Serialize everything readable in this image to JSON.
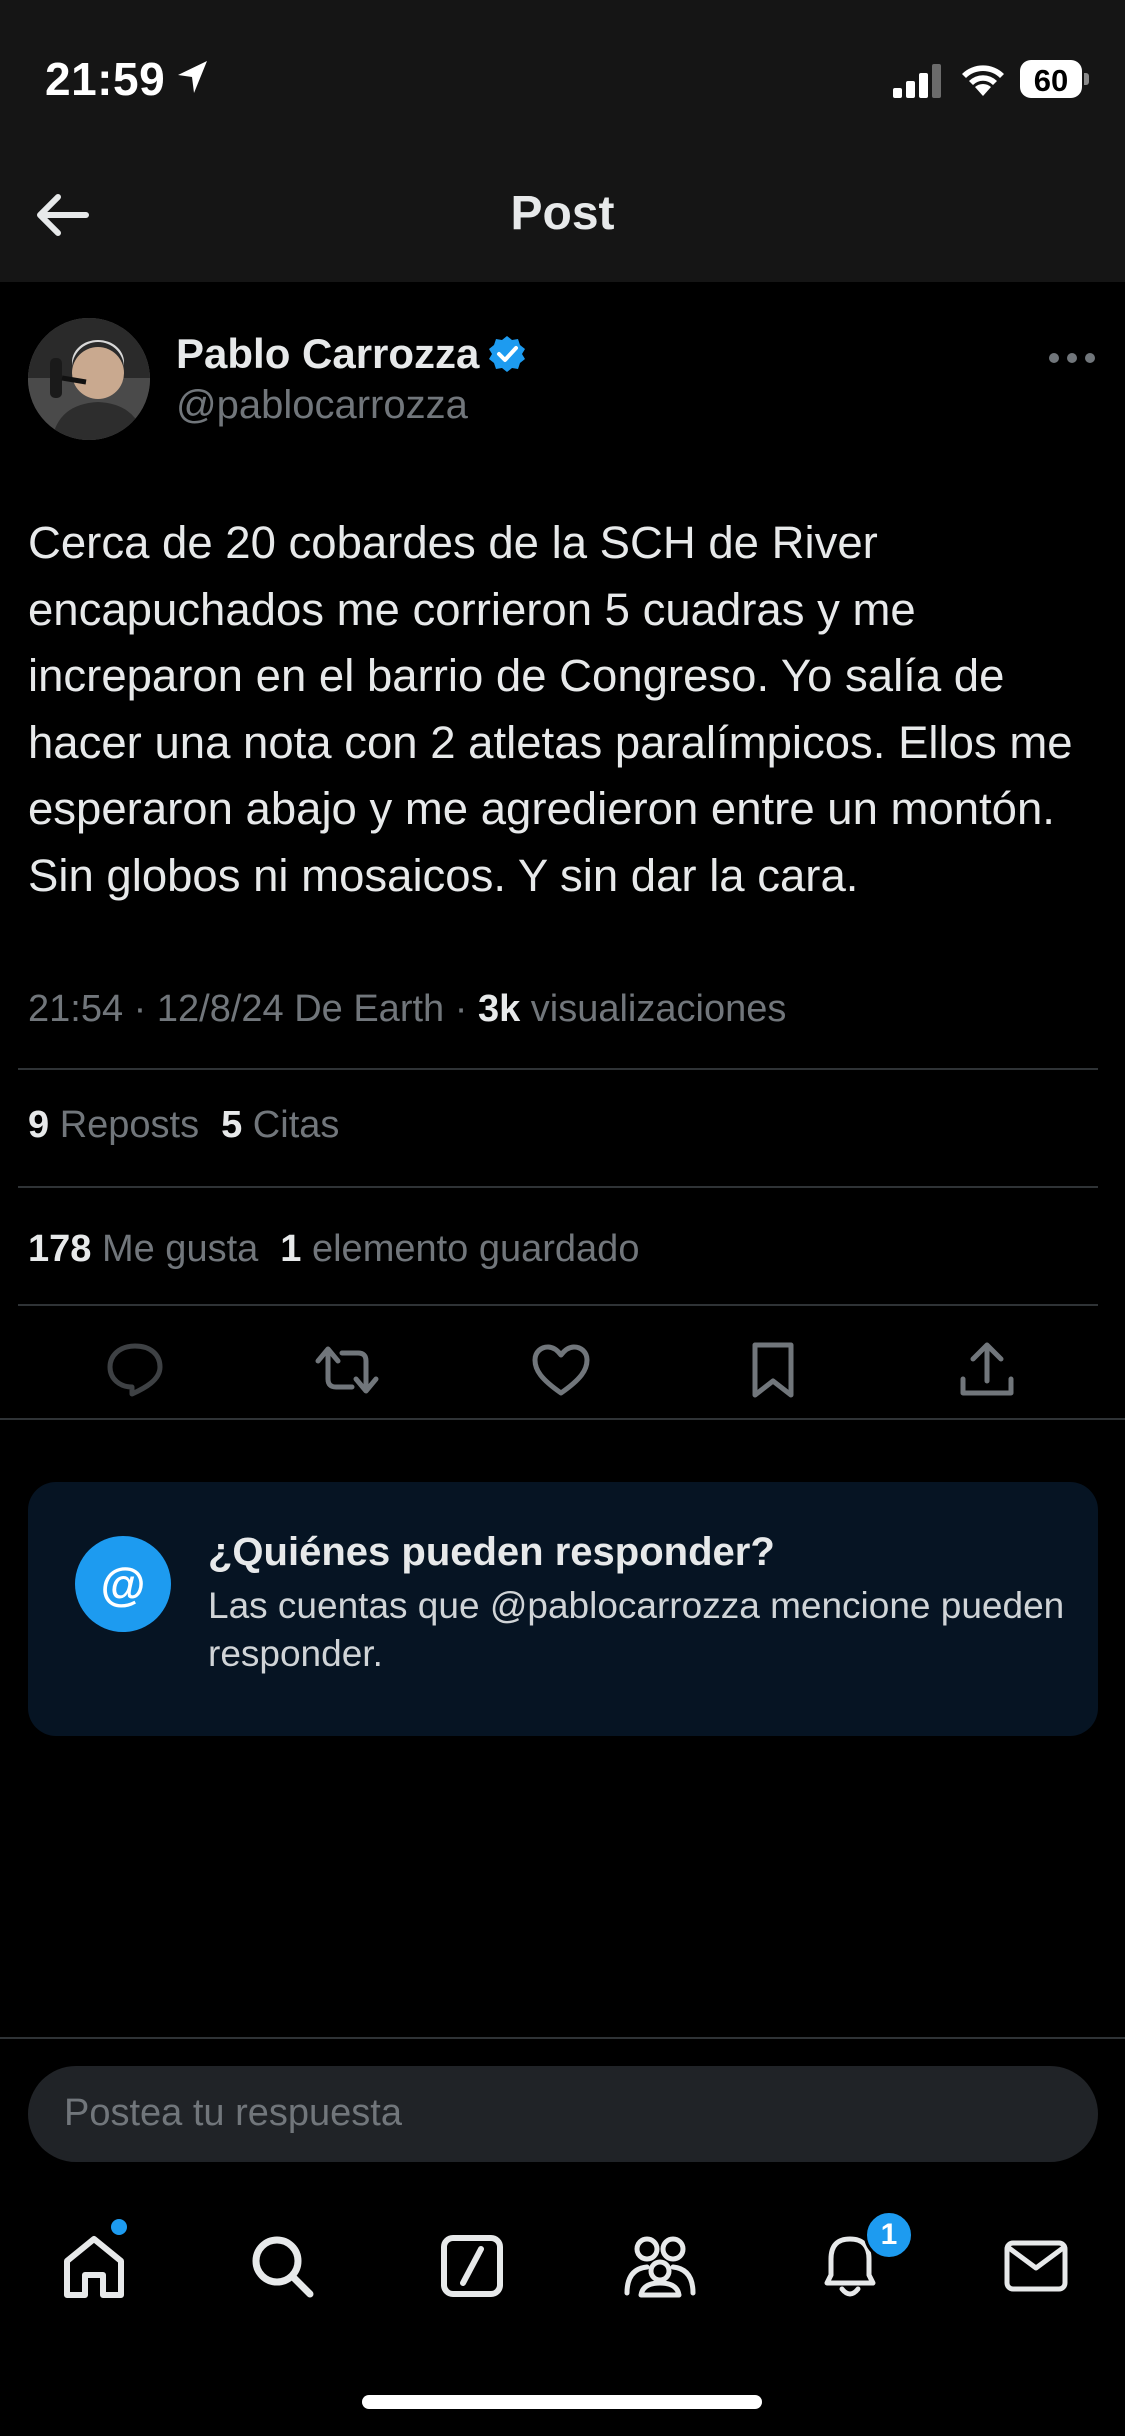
{
  "status_bar": {
    "time": "21:59",
    "battery": "60"
  },
  "nav": {
    "title": "Post"
  },
  "author": {
    "name": "Pablo Carrozza",
    "handle": "@pablocarrozza"
  },
  "post": {
    "text": "Cerca de 20 cobardes de la SCH de River encapuchados me corrieron 5 cuadras y me increparon en el barrio de Congreso. Yo salía de hacer una nota con 2 atletas paralímpicos. Ellos me esperaron abajo y me agredieron entre un montón. Sin globos ni mosaicos. Y sin dar la cara.",
    "meta_prefix": "21:54 · 12/8/24 De Earth · ",
    "views_count": "3k",
    "views_label": " visualizaciones"
  },
  "stats": {
    "reposts_count": "9",
    "reposts_label": " Reposts",
    "quotes_count": "5",
    "quotes_label": " Citas",
    "likes_count": "178",
    "likes_label": " Me gusta",
    "bookmarks_count": "1",
    "bookmarks_label": " elemento guardado"
  },
  "reply_card": {
    "icon": "@",
    "title": "¿Quiénes pueden responder?",
    "description": "Las cuentas que @pablocarrozza mencione pueden responder."
  },
  "reply_input": {
    "placeholder": "Postea tu respuesta"
  },
  "tabbar": {
    "notifications_badge": "1"
  },
  "colors": {
    "accent": "#1d9bf0",
    "background": "#000000",
    "muted": "#71767b",
    "card": "#061423"
  },
  "icons": [
    "location-arrow-icon",
    "signal-icon",
    "wifi-icon",
    "back-arrow-icon",
    "verified-icon",
    "more-icon",
    "reply-icon",
    "repost-icon",
    "like-icon",
    "bookmark-icon",
    "share-icon",
    "home-icon",
    "search-icon",
    "grok-icon",
    "communities-icon",
    "notifications-icon",
    "messages-icon"
  ]
}
